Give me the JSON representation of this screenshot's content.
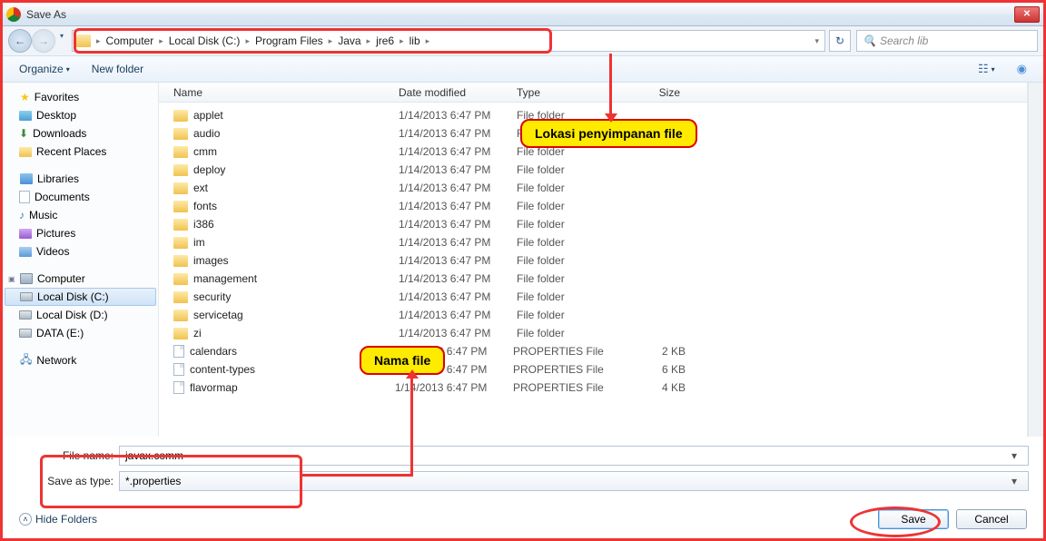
{
  "window": {
    "title": "Save As"
  },
  "breadcrumb": {
    "segments": [
      "Computer",
      "Local Disk (C:)",
      "Program Files",
      "Java",
      "jre6",
      "lib"
    ]
  },
  "search": {
    "placeholder": "Search lib"
  },
  "toolbar": {
    "organize": "Organize",
    "newfolder": "New folder"
  },
  "columns": {
    "name": "Name",
    "date": "Date modified",
    "type": "Type",
    "size": "Size"
  },
  "sidebar": {
    "favorites": {
      "label": "Favorites",
      "items": [
        "Desktop",
        "Downloads",
        "Recent Places"
      ]
    },
    "libraries": {
      "label": "Libraries",
      "items": [
        "Documents",
        "Music",
        "Pictures",
        "Videos"
      ]
    },
    "computer": {
      "label": "Computer",
      "items": [
        "Local Disk (C:)",
        "Local Disk (D:)",
        "DATA (E:)"
      ]
    },
    "network": {
      "label": "Network"
    }
  },
  "files": [
    {
      "name": "applet",
      "date": "1/14/2013 6:47 PM",
      "type": "File folder",
      "size": "",
      "kind": "folder"
    },
    {
      "name": "audio",
      "date": "1/14/2013 6:47 PM",
      "type": "File folder",
      "size": "",
      "kind": "folder"
    },
    {
      "name": "cmm",
      "date": "1/14/2013 6:47 PM",
      "type": "File folder",
      "size": "",
      "kind": "folder"
    },
    {
      "name": "deploy",
      "date": "1/14/2013 6:47 PM",
      "type": "File folder",
      "size": "",
      "kind": "folder"
    },
    {
      "name": "ext",
      "date": "1/14/2013 6:47 PM",
      "type": "File folder",
      "size": "",
      "kind": "folder"
    },
    {
      "name": "fonts",
      "date": "1/14/2013 6:47 PM",
      "type": "File folder",
      "size": "",
      "kind": "folder"
    },
    {
      "name": "i386",
      "date": "1/14/2013 6:47 PM",
      "type": "File folder",
      "size": "",
      "kind": "folder"
    },
    {
      "name": "im",
      "date": "1/14/2013 6:47 PM",
      "type": "File folder",
      "size": "",
      "kind": "folder"
    },
    {
      "name": "images",
      "date": "1/14/2013 6:47 PM",
      "type": "File folder",
      "size": "",
      "kind": "folder"
    },
    {
      "name": "management",
      "date": "1/14/2013 6:47 PM",
      "type": "File folder",
      "size": "",
      "kind": "folder"
    },
    {
      "name": "security",
      "date": "1/14/2013 6:47 PM",
      "type": "File folder",
      "size": "",
      "kind": "folder"
    },
    {
      "name": "servicetag",
      "date": "1/14/2013 6:47 PM",
      "type": "File folder",
      "size": "",
      "kind": "folder"
    },
    {
      "name": "zi",
      "date": "1/14/2013 6:47 PM",
      "type": "File folder",
      "size": "",
      "kind": "folder"
    },
    {
      "name": "calendars",
      "date": "1/14/2013 6:47 PM",
      "type": "PROPERTIES File",
      "size": "2 KB",
      "kind": "file"
    },
    {
      "name": "content-types",
      "date": "1/14/2013 6:47 PM",
      "type": "PROPERTIES File",
      "size": "6 KB",
      "kind": "file"
    },
    {
      "name": "flavormap",
      "date": "1/14/2013 6:47 PM",
      "type": "PROPERTIES File",
      "size": "4 KB",
      "kind": "file"
    }
  ],
  "form": {
    "filename_label": "File name:",
    "filename_value": "javax.comm",
    "type_label": "Save as type:",
    "type_value": "*.properties"
  },
  "footer": {
    "hide": "Hide Folders",
    "save": "Save",
    "cancel": "Cancel"
  },
  "annotations": {
    "location": "Lokasi penyimpanan file",
    "filename": "Nama file"
  }
}
